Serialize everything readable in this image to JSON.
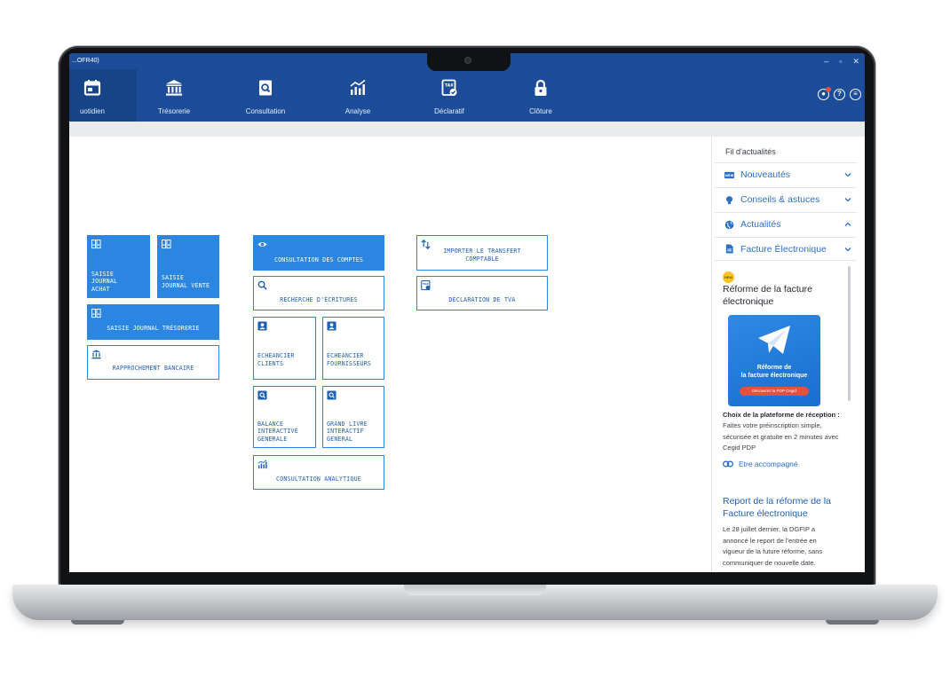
{
  "window": {
    "title": "...OFR40)",
    "controls": [
      "–",
      "▫",
      "✕"
    ]
  },
  "nav": {
    "items": [
      {
        "label": "uotidien",
        "icon": "calendar-icon",
        "active": true
      },
      {
        "label": "Trésorerie",
        "icon": "bank-icon"
      },
      {
        "label": "Consultation",
        "icon": "doc-search-icon"
      },
      {
        "label": "Analyse",
        "icon": "chart-icon"
      },
      {
        "label": "Déclaratif",
        "icon": "tax-doc-icon"
      },
      {
        "label": "Clôture",
        "icon": "lock-icon"
      }
    ],
    "right_icons": [
      "notification-icon",
      "help-icon",
      "menu-icon"
    ]
  },
  "tiles": {
    "saisie_achat": "SAISIE\nJOURNAL\nACHAT",
    "saisie_vente": "SAISIE\nJOURNAL VENTE",
    "saisie_tresorerie": "SAISIE JOURNAL TRÉSORERIE",
    "rapprochement": "RAPPROCHEMENT BANCAIRE",
    "consultation_comptes": "CONSULTATION DES COMPTES",
    "recherche": "RECHERCHE D'ÉCRITURES",
    "echeancier_clients": "ÉCHEANCIER\nCLIENTS",
    "echeancier_fournisseurs": "ÉCHEANCIER\nFOURNISSEURS",
    "balance": "BALANCE\nINTERACTIVE\nGENERALE",
    "grand_livre": "GRAND LIVRE\nINTERACTIF\nGENERAL",
    "consultation_analytique": "CONSULTATION ANALYTIQUE",
    "importer_transfert": "IMPORTER LE TRANSFERT\nCOMPTABLE",
    "declaration_tva": "DÉCLARATION DE TVA"
  },
  "panel": {
    "title": "Fil d'actualités",
    "sections": [
      {
        "label": "Nouveautés",
        "icon": "new-icon",
        "expanded": false
      },
      {
        "label": "Conseils & astuces",
        "icon": "lightbulb-icon",
        "expanded": false
      },
      {
        "label": "Actualités",
        "icon": "globe-icon",
        "expanded": true
      },
      {
        "label": "Facture Électronique",
        "icon": "file-icon",
        "expanded": false
      }
    ],
    "badge": "NEW",
    "article1": {
      "title": "Réforme de la facture électronique",
      "promo_title": "Réforme de\nla facture électronique",
      "promo_button": "Découvrez la PDP Cegid",
      "lead": "Choix de la plateforme de réception :",
      "body": "Faites votre préinscription simple, sécurisée et gratuite en 2 minutes avec Cegid PDP",
      "link": "Etre accompagné"
    },
    "article2": {
      "title": "Report de la réforme de la Facture électronique",
      "body": "Le 28 juillet dernier, la DGFIP a annoncé le report de l'entrée en vigueur de la future réforme, sans communiquer de nouvelle date."
    }
  },
  "colors": {
    "nav_bg": "#1d4d99",
    "tile_blue": "#2b86e1",
    "link_blue": "#2c6fc7"
  }
}
